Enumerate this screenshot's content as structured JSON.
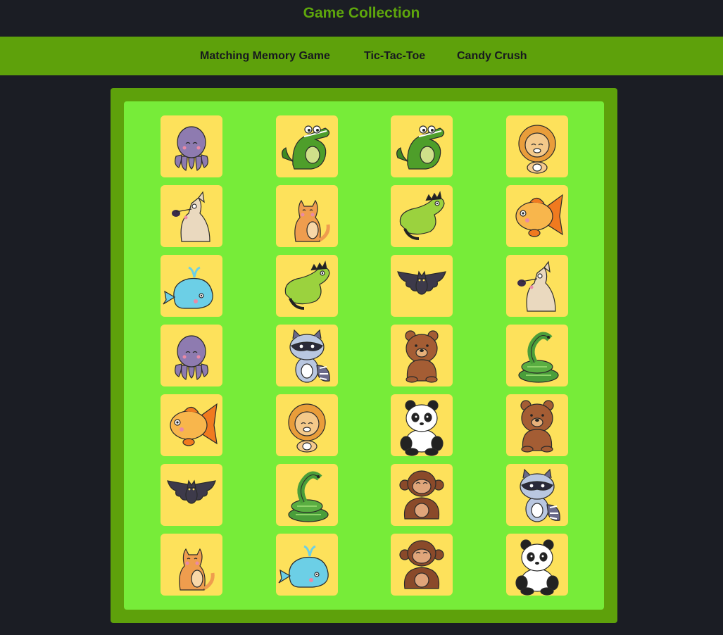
{
  "header": {
    "title": "Game Collection"
  },
  "nav": {
    "items": [
      {
        "label": "Matching Memory Game"
      },
      {
        "label": "Tic-Tac-Toe"
      },
      {
        "label": "Candy Crush"
      }
    ]
  },
  "colors": {
    "page_bg": "#1b1d24",
    "title": "#5ea60c",
    "nav_bg": "#5ea10b",
    "board_frame": "#5ea10b",
    "board_bg": "#77ec39",
    "card_bg": "#fde15b"
  },
  "board": {
    "rows": 7,
    "cols": 4,
    "cards": [
      "octopus-icon",
      "crocodile-icon",
      "crocodile-icon",
      "lion-icon",
      "dog-icon",
      "cat-icon",
      "iguana-icon",
      "goldfish-icon",
      "whale-icon",
      "iguana-icon",
      "bat-icon",
      "dog-icon",
      "octopus-icon",
      "raccoon-icon",
      "bear-icon",
      "snake-icon",
      "goldfish-icon",
      "lion-icon",
      "panda-icon",
      "bear-icon",
      "bat-icon",
      "snake-icon",
      "monkey-icon",
      "raccoon-icon",
      "cat-icon",
      "whale-icon",
      "monkey-icon",
      "panda-icon"
    ]
  }
}
